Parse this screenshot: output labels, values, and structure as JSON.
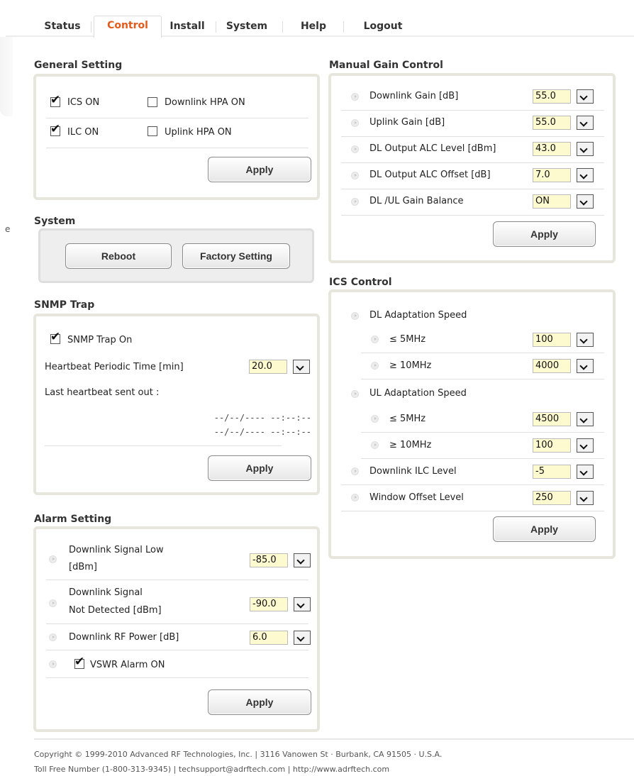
{
  "tabs": [
    {
      "label": "Status"
    },
    {
      "label": "Control"
    },
    {
      "label": "Install"
    },
    {
      "label": "System"
    },
    {
      "label": "Help"
    },
    {
      "label": "Logout"
    }
  ],
  "stray_text": "e",
  "general": {
    "title": "General Setting",
    "ics_on": "ICS ON",
    "downlink_hpa_on": "Downlink HPA ON",
    "ilc_on": "ILC ON",
    "uplink_hpa_on": "Uplink HPA ON",
    "apply": "Apply"
  },
  "system": {
    "title": "System",
    "reboot": "Reboot",
    "factory": "Factory Setting"
  },
  "snmp": {
    "title": "SNMP Trap",
    "trap_on": "SNMP Trap On",
    "heartbeat_label": "Heartbeat Periodic Time [min]",
    "heartbeat_value": "20.0",
    "last_label": "Last heartbeat sent out :",
    "last_1": "--/--/---- --:--:--",
    "last_2": "--/--/---- --:--:--",
    "apply": "Apply"
  },
  "alarm": {
    "title": "Alarm Setting",
    "dl_low_1": "Downlink Signal Low",
    "dl_low_2": "[dBm]",
    "dl_low_value": "-85.0",
    "dl_nd_1": "Downlink Signal",
    "dl_nd_2": "Not Detected [dBm]",
    "dl_nd_value": "-90.0",
    "dl_rf_label": "Downlink RF Power [dB]",
    "dl_rf_value": "6.0",
    "vswr": "VSWR Alarm ON",
    "apply": "Apply"
  },
  "mgc": {
    "title": "Manual Gain Control",
    "rows": [
      {
        "label": "Downlink Gain [dB]",
        "value": "55.0"
      },
      {
        "label": "Uplink Gain [dB]",
        "value": "55.0"
      },
      {
        "label": "DL Output ALC Level [dBm]",
        "value": "43.0"
      },
      {
        "label": "DL Output ALC Offset [dB]",
        "value": "7.0"
      },
      {
        "label": "DL /UL Gain Balance",
        "value": "ON"
      }
    ],
    "apply": "Apply"
  },
  "ics": {
    "title": "ICS Control",
    "dl_speed": "DL Adaptation Speed",
    "dl_le5": "≤ 5MHz",
    "dl_le5_value": "100",
    "dl_ge10": "≥ 10MHz",
    "dl_ge10_value": "4000",
    "ul_speed": "UL Adaptation Speed",
    "ul_le5": "≤ 5MHz",
    "ul_le5_value": "4500",
    "ul_ge10": "≥ 10MHz",
    "ul_ge10_value": "100",
    "dl_ilc_label": "Downlink ILC Level",
    "dl_ilc_value": "-5",
    "window_label": "Window Offset Level",
    "window_value": "250",
    "apply": "Apply"
  },
  "footer": {
    "line1": "Copyright © 1999-2010 Advanced RF Technologies, Inc. | 3116 Vanowen St · Burbank, CA 91505 · U.S.A.",
    "line2": "Toll Free Number (1-800-313-9345) | techsupport@adrftech.com | http://www.adrftech.com"
  }
}
